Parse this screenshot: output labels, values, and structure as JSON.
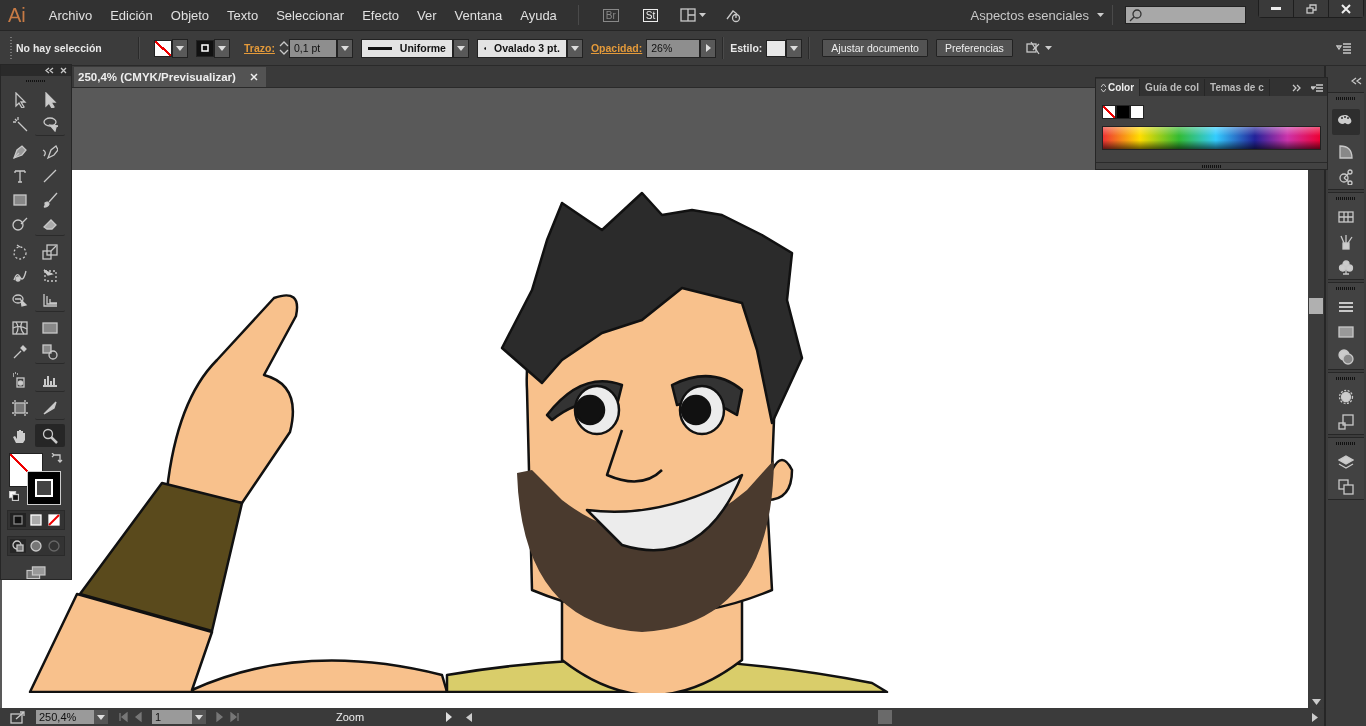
{
  "app": {
    "logo": "Ai",
    "bridge": "Br",
    "stock": "St"
  },
  "menu": [
    {
      "label": "Archivo"
    },
    {
      "label": "Edición"
    },
    {
      "label": "Objeto"
    },
    {
      "label": "Texto"
    },
    {
      "label": "Seleccionar"
    },
    {
      "label": "Efecto"
    },
    {
      "label": "Ver"
    },
    {
      "label": "Ventana"
    },
    {
      "label": "Ayuda"
    }
  ],
  "workspace": {
    "label": "Aspectos esenciales"
  },
  "control_bar": {
    "selection": "No hay selección",
    "stroke_label": "Trazo:",
    "stroke_weight": "0,1 pt",
    "profile": "Uniforme",
    "brush": "Ovalado 3 pt.",
    "opacity_label": "Opacidad:",
    "opacity": "26%",
    "style_label": "Estilo:",
    "buttons": [
      "Ajustar documento",
      "Preferencias"
    ]
  },
  "document_tab": {
    "title": "250,4% (CMYK/Previsualizar)"
  },
  "tools": [
    {
      "selected": false
    },
    {
      "selected": false
    },
    {
      "selected": false
    },
    {
      "selected": false
    },
    {
      "selected": false
    },
    {
      "selected": false
    },
    {
      "selected": false
    },
    {
      "selected": false
    },
    {
      "selected": false
    },
    {
      "selected": false
    },
    {
      "selected": false
    },
    {
      "selected": false
    },
    {
      "selected": false
    },
    {
      "selected": false
    },
    {
      "selected": false
    },
    {
      "selected": false
    },
    {
      "selected": false
    },
    {
      "selected": false
    },
    {
      "selected": false
    },
    {
      "selected": false
    },
    {
      "selected": false
    },
    {
      "selected": false
    },
    {
      "selected": false
    },
    {
      "selected": false
    },
    {
      "selected": false
    },
    {
      "selected": false
    },
    {
      "selected": false
    },
    {
      "selected": true
    }
  ],
  "color_panel": {
    "tabs": [
      {
        "label": "Color",
        "selected": true
      },
      {
        "label": "Guía de col",
        "selected": false
      },
      {
        "label": "Temas de c",
        "selected": false
      }
    ]
  },
  "status_bar": {
    "zoom": "250,4%",
    "page": "1",
    "tool": "Zoom"
  }
}
